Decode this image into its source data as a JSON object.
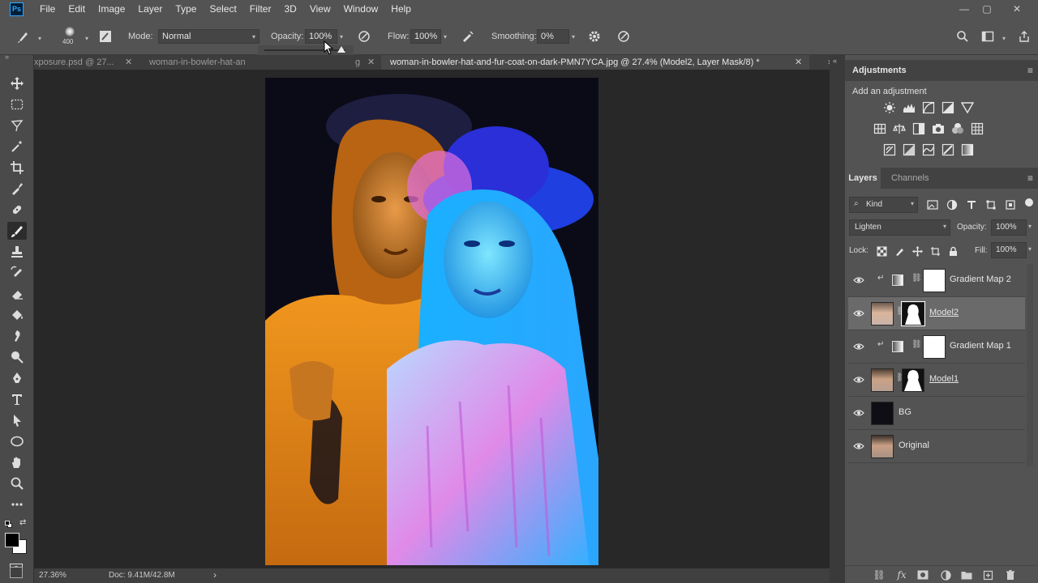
{
  "menu": [
    "File",
    "Edit",
    "Image",
    "Layer",
    "Type",
    "Select",
    "Filter",
    "3D",
    "View",
    "Window",
    "Help"
  ],
  "app_logo": "Ps",
  "window_controls": {
    "minimize": "—",
    "restore": "▢",
    "close": "✕"
  },
  "options": {
    "brush_size": "400",
    "mode_label": "Mode:",
    "mode_value": "Normal",
    "opacity_label": "Opacity:",
    "opacity_value": "100%",
    "flow_label": "Flow:",
    "flow_value": "100%",
    "smoothing_label": "Smoothing:",
    "smoothing_value": "0%"
  },
  "tabs": [
    {
      "label": "xposure.psd @ 27...",
      "close": "✕"
    },
    {
      "label": "woman-in-bowler-hat-an",
      "suffix": "g",
      "close": "✕"
    },
    {
      "label": "woman-in-bowler-hat-and-fur-coat-on-dark-PMN7YCA.jpg @ 27.4% (Model2, Layer Mask/8) *",
      "close": "✕"
    }
  ],
  "status": {
    "zoom": "27.36%",
    "doc": "Doc: 9.41M/42.8M",
    "arrow": "›"
  },
  "adjustments": {
    "title": "Adjustments",
    "subtitle": "Add an adjustment",
    "icons": [
      "brightness-contrast-icon",
      "levels-icon",
      "curves-icon",
      "exposure-icon",
      "vibrance-icon",
      "hue-saturation-icon",
      "color-balance-icon",
      "black-white-icon",
      "photo-filter-icon",
      "channel-mixer-icon",
      "color-lookup-icon",
      "invert-icon",
      "posterize-icon",
      "threshold-icon",
      "selective-color-icon",
      "gradient-map-icon"
    ]
  },
  "layers_panel": {
    "tabs": [
      "Layers",
      "Channels"
    ],
    "kind": "Kind",
    "blend_mode": "Lighten",
    "opacity_label": "Opacity:",
    "opacity_value": "100%",
    "lock_label": "Lock:",
    "fill_label": "Fill:",
    "fill_value": "100%",
    "layers": [
      {
        "name": "Gradient Map 2",
        "type": "adjustment",
        "clipped": true,
        "selected": false
      },
      {
        "name": "Model2",
        "type": "masked",
        "clipped": false,
        "selected": true
      },
      {
        "name": "Gradient Map 1",
        "type": "adjustment",
        "clipped": true,
        "selected": false
      },
      {
        "name": "Model1",
        "type": "masked",
        "clipped": false,
        "selected": false
      },
      {
        "name": "BG",
        "type": "fill",
        "clipped": false,
        "selected": false
      },
      {
        "name": "Original",
        "type": "photo",
        "clipped": false,
        "selected": false
      }
    ]
  },
  "colors": {
    "ui_dark": "#282828",
    "panel": "#535353",
    "accent_blue": "#31a8ff",
    "orange_model": "#e88a1a",
    "blue_model": "#2aa6ff"
  }
}
